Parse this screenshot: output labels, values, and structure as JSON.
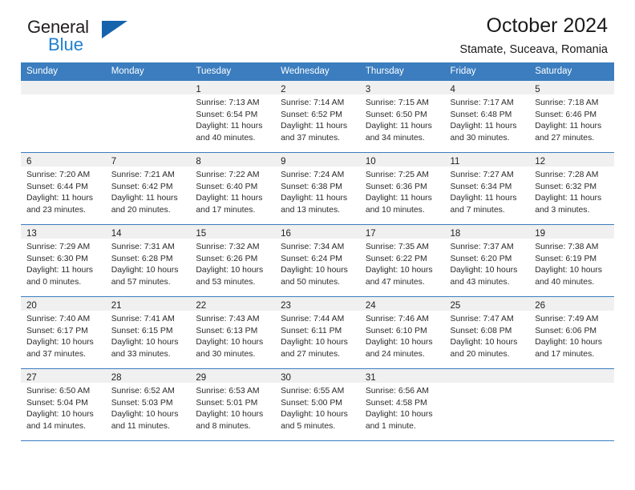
{
  "brand": {
    "name_part1": "General",
    "name_part2": "Blue",
    "triangle_color": "#1563ac",
    "blue_color": "#1f7fd0"
  },
  "header": {
    "title": "October 2024",
    "subtitle": "Stamate, Suceava, Romania"
  },
  "theme": {
    "header_row_bg": "#3b7dbf",
    "daynum_strip_bg": "#f0f0f0",
    "grid_line": "#3b7dbf"
  },
  "weekdays": [
    "Sunday",
    "Monday",
    "Tuesday",
    "Wednesday",
    "Thursday",
    "Friday",
    "Saturday"
  ],
  "weeks": [
    [
      {
        "empty": true
      },
      {
        "empty": true
      },
      {
        "day": "1",
        "sunrise": "Sunrise: 7:13 AM",
        "sunset": "Sunset: 6:54 PM",
        "daylight1": "Daylight: 11 hours",
        "daylight2": "and 40 minutes."
      },
      {
        "day": "2",
        "sunrise": "Sunrise: 7:14 AM",
        "sunset": "Sunset: 6:52 PM",
        "daylight1": "Daylight: 11 hours",
        "daylight2": "and 37 minutes."
      },
      {
        "day": "3",
        "sunrise": "Sunrise: 7:15 AM",
        "sunset": "Sunset: 6:50 PM",
        "daylight1": "Daylight: 11 hours",
        "daylight2": "and 34 minutes."
      },
      {
        "day": "4",
        "sunrise": "Sunrise: 7:17 AM",
        "sunset": "Sunset: 6:48 PM",
        "daylight1": "Daylight: 11 hours",
        "daylight2": "and 30 minutes."
      },
      {
        "day": "5",
        "sunrise": "Sunrise: 7:18 AM",
        "sunset": "Sunset: 6:46 PM",
        "daylight1": "Daylight: 11 hours",
        "daylight2": "and 27 minutes."
      }
    ],
    [
      {
        "day": "6",
        "sunrise": "Sunrise: 7:20 AM",
        "sunset": "Sunset: 6:44 PM",
        "daylight1": "Daylight: 11 hours",
        "daylight2": "and 23 minutes."
      },
      {
        "day": "7",
        "sunrise": "Sunrise: 7:21 AM",
        "sunset": "Sunset: 6:42 PM",
        "daylight1": "Daylight: 11 hours",
        "daylight2": "and 20 minutes."
      },
      {
        "day": "8",
        "sunrise": "Sunrise: 7:22 AM",
        "sunset": "Sunset: 6:40 PM",
        "daylight1": "Daylight: 11 hours",
        "daylight2": "and 17 minutes."
      },
      {
        "day": "9",
        "sunrise": "Sunrise: 7:24 AM",
        "sunset": "Sunset: 6:38 PM",
        "daylight1": "Daylight: 11 hours",
        "daylight2": "and 13 minutes."
      },
      {
        "day": "10",
        "sunrise": "Sunrise: 7:25 AM",
        "sunset": "Sunset: 6:36 PM",
        "daylight1": "Daylight: 11 hours",
        "daylight2": "and 10 minutes."
      },
      {
        "day": "11",
        "sunrise": "Sunrise: 7:27 AM",
        "sunset": "Sunset: 6:34 PM",
        "daylight1": "Daylight: 11 hours",
        "daylight2": "and 7 minutes."
      },
      {
        "day": "12",
        "sunrise": "Sunrise: 7:28 AM",
        "sunset": "Sunset: 6:32 PM",
        "daylight1": "Daylight: 11 hours",
        "daylight2": "and 3 minutes."
      }
    ],
    [
      {
        "day": "13",
        "sunrise": "Sunrise: 7:29 AM",
        "sunset": "Sunset: 6:30 PM",
        "daylight1": "Daylight: 11 hours",
        "daylight2": "and 0 minutes."
      },
      {
        "day": "14",
        "sunrise": "Sunrise: 7:31 AM",
        "sunset": "Sunset: 6:28 PM",
        "daylight1": "Daylight: 10 hours",
        "daylight2": "and 57 minutes."
      },
      {
        "day": "15",
        "sunrise": "Sunrise: 7:32 AM",
        "sunset": "Sunset: 6:26 PM",
        "daylight1": "Daylight: 10 hours",
        "daylight2": "and 53 minutes."
      },
      {
        "day": "16",
        "sunrise": "Sunrise: 7:34 AM",
        "sunset": "Sunset: 6:24 PM",
        "daylight1": "Daylight: 10 hours",
        "daylight2": "and 50 minutes."
      },
      {
        "day": "17",
        "sunrise": "Sunrise: 7:35 AM",
        "sunset": "Sunset: 6:22 PM",
        "daylight1": "Daylight: 10 hours",
        "daylight2": "and 47 minutes."
      },
      {
        "day": "18",
        "sunrise": "Sunrise: 7:37 AM",
        "sunset": "Sunset: 6:20 PM",
        "daylight1": "Daylight: 10 hours",
        "daylight2": "and 43 minutes."
      },
      {
        "day": "19",
        "sunrise": "Sunrise: 7:38 AM",
        "sunset": "Sunset: 6:19 PM",
        "daylight1": "Daylight: 10 hours",
        "daylight2": "and 40 minutes."
      }
    ],
    [
      {
        "day": "20",
        "sunrise": "Sunrise: 7:40 AM",
        "sunset": "Sunset: 6:17 PM",
        "daylight1": "Daylight: 10 hours",
        "daylight2": "and 37 minutes."
      },
      {
        "day": "21",
        "sunrise": "Sunrise: 7:41 AM",
        "sunset": "Sunset: 6:15 PM",
        "daylight1": "Daylight: 10 hours",
        "daylight2": "and 33 minutes."
      },
      {
        "day": "22",
        "sunrise": "Sunrise: 7:43 AM",
        "sunset": "Sunset: 6:13 PM",
        "daylight1": "Daylight: 10 hours",
        "daylight2": "and 30 minutes."
      },
      {
        "day": "23",
        "sunrise": "Sunrise: 7:44 AM",
        "sunset": "Sunset: 6:11 PM",
        "daylight1": "Daylight: 10 hours",
        "daylight2": "and 27 minutes."
      },
      {
        "day": "24",
        "sunrise": "Sunrise: 7:46 AM",
        "sunset": "Sunset: 6:10 PM",
        "daylight1": "Daylight: 10 hours",
        "daylight2": "and 24 minutes."
      },
      {
        "day": "25",
        "sunrise": "Sunrise: 7:47 AM",
        "sunset": "Sunset: 6:08 PM",
        "daylight1": "Daylight: 10 hours",
        "daylight2": "and 20 minutes."
      },
      {
        "day": "26",
        "sunrise": "Sunrise: 7:49 AM",
        "sunset": "Sunset: 6:06 PM",
        "daylight1": "Daylight: 10 hours",
        "daylight2": "and 17 minutes."
      }
    ],
    [
      {
        "day": "27",
        "sunrise": "Sunrise: 6:50 AM",
        "sunset": "Sunset: 5:04 PM",
        "daylight1": "Daylight: 10 hours",
        "daylight2": "and 14 minutes."
      },
      {
        "day": "28",
        "sunrise": "Sunrise: 6:52 AM",
        "sunset": "Sunset: 5:03 PM",
        "daylight1": "Daylight: 10 hours",
        "daylight2": "and 11 minutes."
      },
      {
        "day": "29",
        "sunrise": "Sunrise: 6:53 AM",
        "sunset": "Sunset: 5:01 PM",
        "daylight1": "Daylight: 10 hours",
        "daylight2": "and 8 minutes."
      },
      {
        "day": "30",
        "sunrise": "Sunrise: 6:55 AM",
        "sunset": "Sunset: 5:00 PM",
        "daylight1": "Daylight: 10 hours",
        "daylight2": "and 5 minutes."
      },
      {
        "day": "31",
        "sunrise": "Sunrise: 6:56 AM",
        "sunset": "Sunset: 4:58 PM",
        "daylight1": "Daylight: 10 hours",
        "daylight2": "and 1 minute."
      },
      {
        "empty": true
      },
      {
        "empty": true
      }
    ]
  ]
}
